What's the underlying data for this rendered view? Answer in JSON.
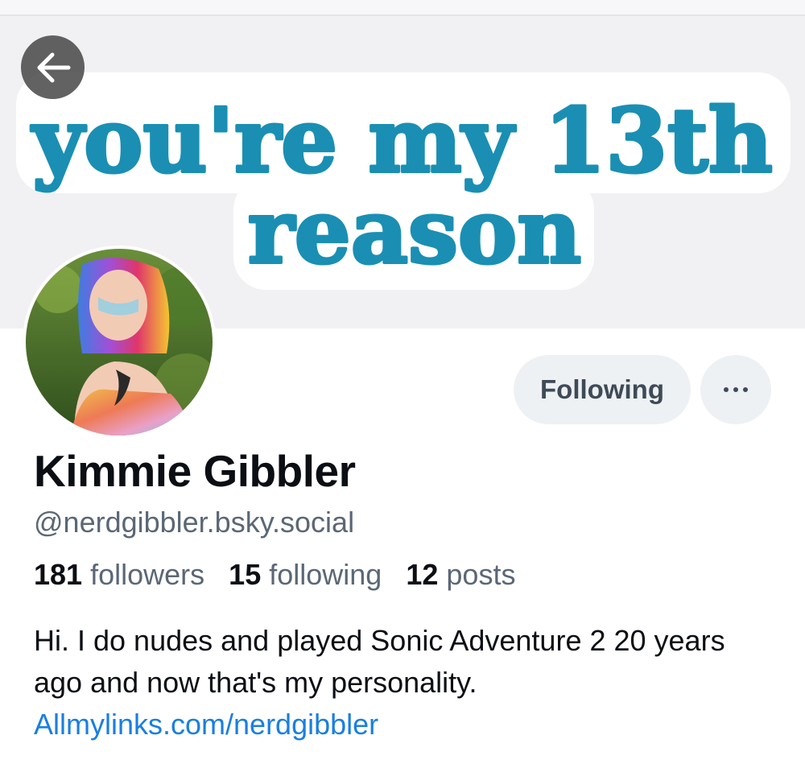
{
  "banner": {
    "line1": "you're my 13th",
    "line2": "reason",
    "text_color": "#1a8fb3"
  },
  "nav": {
    "back_icon": "arrow-left-icon"
  },
  "profile": {
    "display_name": "Kimmie Gibbler",
    "handle": "@nerdgibbler.bsky.social",
    "stats": {
      "followers_count": "181",
      "followers_label": "followers",
      "following_count": "15",
      "following_label": "following",
      "posts_count": "12",
      "posts_label": "posts"
    },
    "bio": "Hi. I do nudes and played Sonic Adventure 2 20 years ago and now that's my personality.",
    "link": "Allmylinks.com/nerdgibbler"
  },
  "actions": {
    "following_label": "Following",
    "more_icon": "ellipsis-icon"
  },
  "colors": {
    "link": "#1a7fe0",
    "muted": "#5b6775",
    "button_bg": "#eef1f4"
  }
}
